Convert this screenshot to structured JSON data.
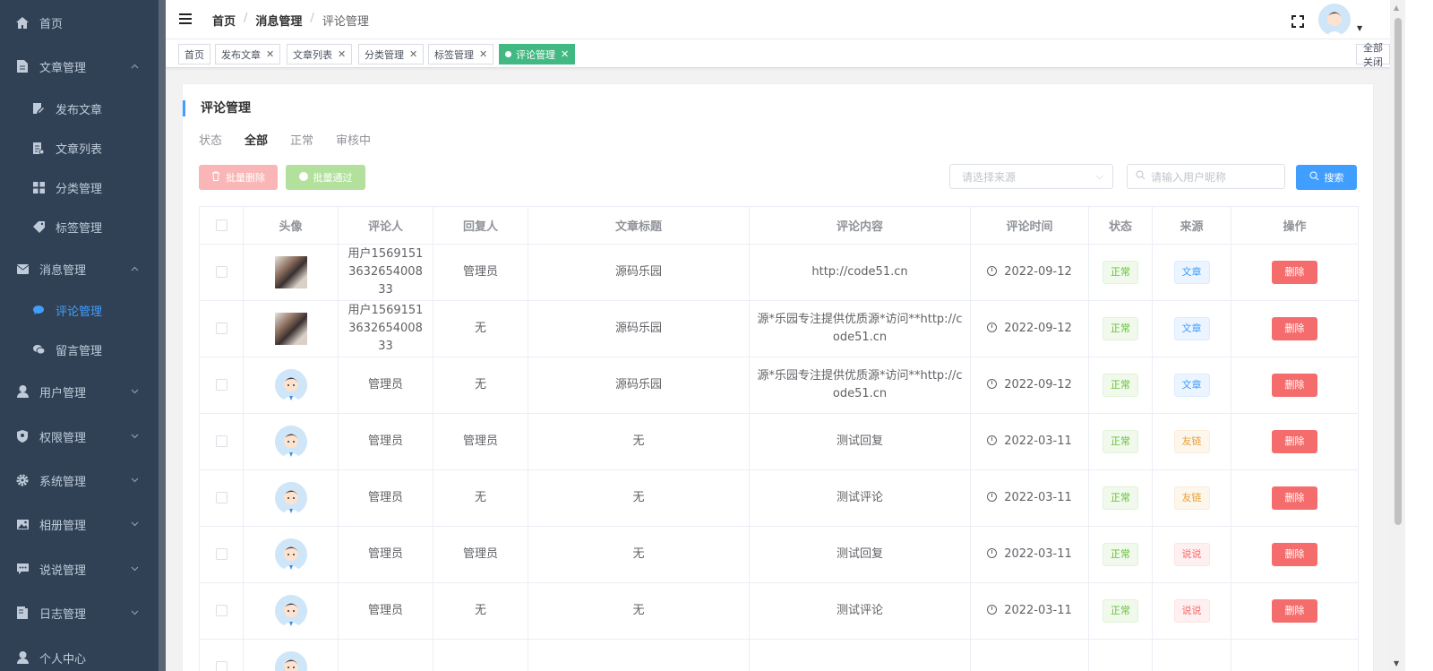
{
  "sidebar": {
    "items": [
      {
        "label": "首页",
        "icon": "home-icon",
        "type": "top",
        "arrow": ""
      },
      {
        "label": "文章管理",
        "icon": "document-icon",
        "type": "top",
        "arrow": "up"
      },
      {
        "label": "发布文章",
        "icon": "edit-icon",
        "type": "sub"
      },
      {
        "label": "文章列表",
        "icon": "list-icon",
        "type": "sub"
      },
      {
        "label": "分类管理",
        "icon": "grid-icon",
        "type": "sub"
      },
      {
        "label": "标签管理",
        "icon": "tag-icon",
        "type": "sub"
      },
      {
        "label": "消息管理",
        "icon": "mail-icon",
        "type": "top",
        "arrow": "up"
      },
      {
        "label": "评论管理",
        "icon": "comment-icon",
        "type": "sub",
        "active": true
      },
      {
        "label": "留言管理",
        "icon": "chat-icon",
        "type": "sub"
      },
      {
        "label": "用户管理",
        "icon": "user-icon",
        "type": "top",
        "arrow": "down"
      },
      {
        "label": "权限管理",
        "icon": "shield-icon",
        "type": "top",
        "arrow": "down"
      },
      {
        "label": "系统管理",
        "icon": "gear-icon",
        "type": "top",
        "arrow": "down"
      },
      {
        "label": "相册管理",
        "icon": "picture-icon",
        "type": "top",
        "arrow": "down"
      },
      {
        "label": "说说管理",
        "icon": "message-icon",
        "type": "top",
        "arrow": "down"
      },
      {
        "label": "日志管理",
        "icon": "log-icon",
        "type": "top",
        "arrow": "down"
      },
      {
        "label": "个人中心",
        "icon": "user-icon",
        "type": "top",
        "arrow": ""
      }
    ]
  },
  "header": {
    "breadcrumb": [
      "首页",
      "消息管理",
      "评论管理"
    ],
    "breadcrumb_sep": "/"
  },
  "tags": {
    "items": [
      {
        "label": "首页",
        "closable": false
      },
      {
        "label": "发布文章",
        "closable": true
      },
      {
        "label": "文章列表",
        "closable": true
      },
      {
        "label": "分类管理",
        "closable": true
      },
      {
        "label": "标签管理",
        "closable": true
      },
      {
        "label": "评论管理",
        "closable": true,
        "active": true
      }
    ],
    "close_all": "全部关闭"
  },
  "main": {
    "title": "评论管理",
    "status_label": "状态",
    "status_options": [
      "全部",
      "正常",
      "审核中"
    ],
    "batch_delete": "批量删除",
    "batch_pass": "批量通过",
    "source_placeholder": "请选择来源",
    "search_placeholder": "请输入用户昵称",
    "search_button": "搜索",
    "columns": [
      "",
      "头像",
      "评论人",
      "回复人",
      "文章标题",
      "评论内容",
      "评论时间",
      "状态",
      "来源",
      "操作"
    ],
    "rows": [
      {
        "avatar": "photo",
        "commenter": "用户1569151363265400833",
        "reply": "管理员",
        "article": "源码乐园",
        "content": "http://code51.cn",
        "time": "2022-09-12",
        "status": "正常",
        "source": "文章",
        "source_type": "primary",
        "action": "删除"
      },
      {
        "avatar": "photo",
        "commenter": "用户1569151363265400833",
        "reply": "无",
        "article": "源码乐园",
        "content": "源*乐园专注提供优质源*访问**http://code51.cn",
        "time": "2022-09-12",
        "status": "正常",
        "source": "文章",
        "source_type": "primary",
        "action": "删除"
      },
      {
        "avatar": "cartoon",
        "commenter": "管理员",
        "reply": "无",
        "article": "源码乐园",
        "content": "源*乐园专注提供优质源*访问**http://code51.cn",
        "time": "2022-09-12",
        "status": "正常",
        "source": "文章",
        "source_type": "primary",
        "action": "删除"
      },
      {
        "avatar": "cartoon",
        "commenter": "管理员",
        "reply": "管理员",
        "article": "无",
        "content": "测试回复",
        "time": "2022-03-11",
        "status": "正常",
        "source": "友链",
        "source_type": "warning",
        "action": "删除"
      },
      {
        "avatar": "cartoon",
        "commenter": "管理员",
        "reply": "无",
        "article": "无",
        "content": "测试评论",
        "time": "2022-03-11",
        "status": "正常",
        "source": "友链",
        "source_type": "warning",
        "action": "删除"
      },
      {
        "avatar": "cartoon",
        "commenter": "管理员",
        "reply": "管理员",
        "article": "无",
        "content": "测试回复",
        "time": "2022-03-11",
        "status": "正常",
        "source": "说说",
        "source_type": "danger",
        "action": "删除"
      },
      {
        "avatar": "cartoon",
        "commenter": "管理员",
        "reply": "无",
        "article": "无",
        "content": "测试评论",
        "time": "2022-03-11",
        "status": "正常",
        "source": "说说",
        "source_type": "danger",
        "action": "删除"
      },
      {
        "avatar": "cartoon",
        "commenter": "",
        "reply": "",
        "article": "",
        "content": "",
        "time": "",
        "status": "",
        "source": "",
        "source_type": "primary",
        "action": ""
      }
    ]
  },
  "colors": {
    "sidebar_bg": "#304156",
    "accent": "#409eff",
    "tag_active": "#42b983",
    "danger": "#f56c6c"
  }
}
